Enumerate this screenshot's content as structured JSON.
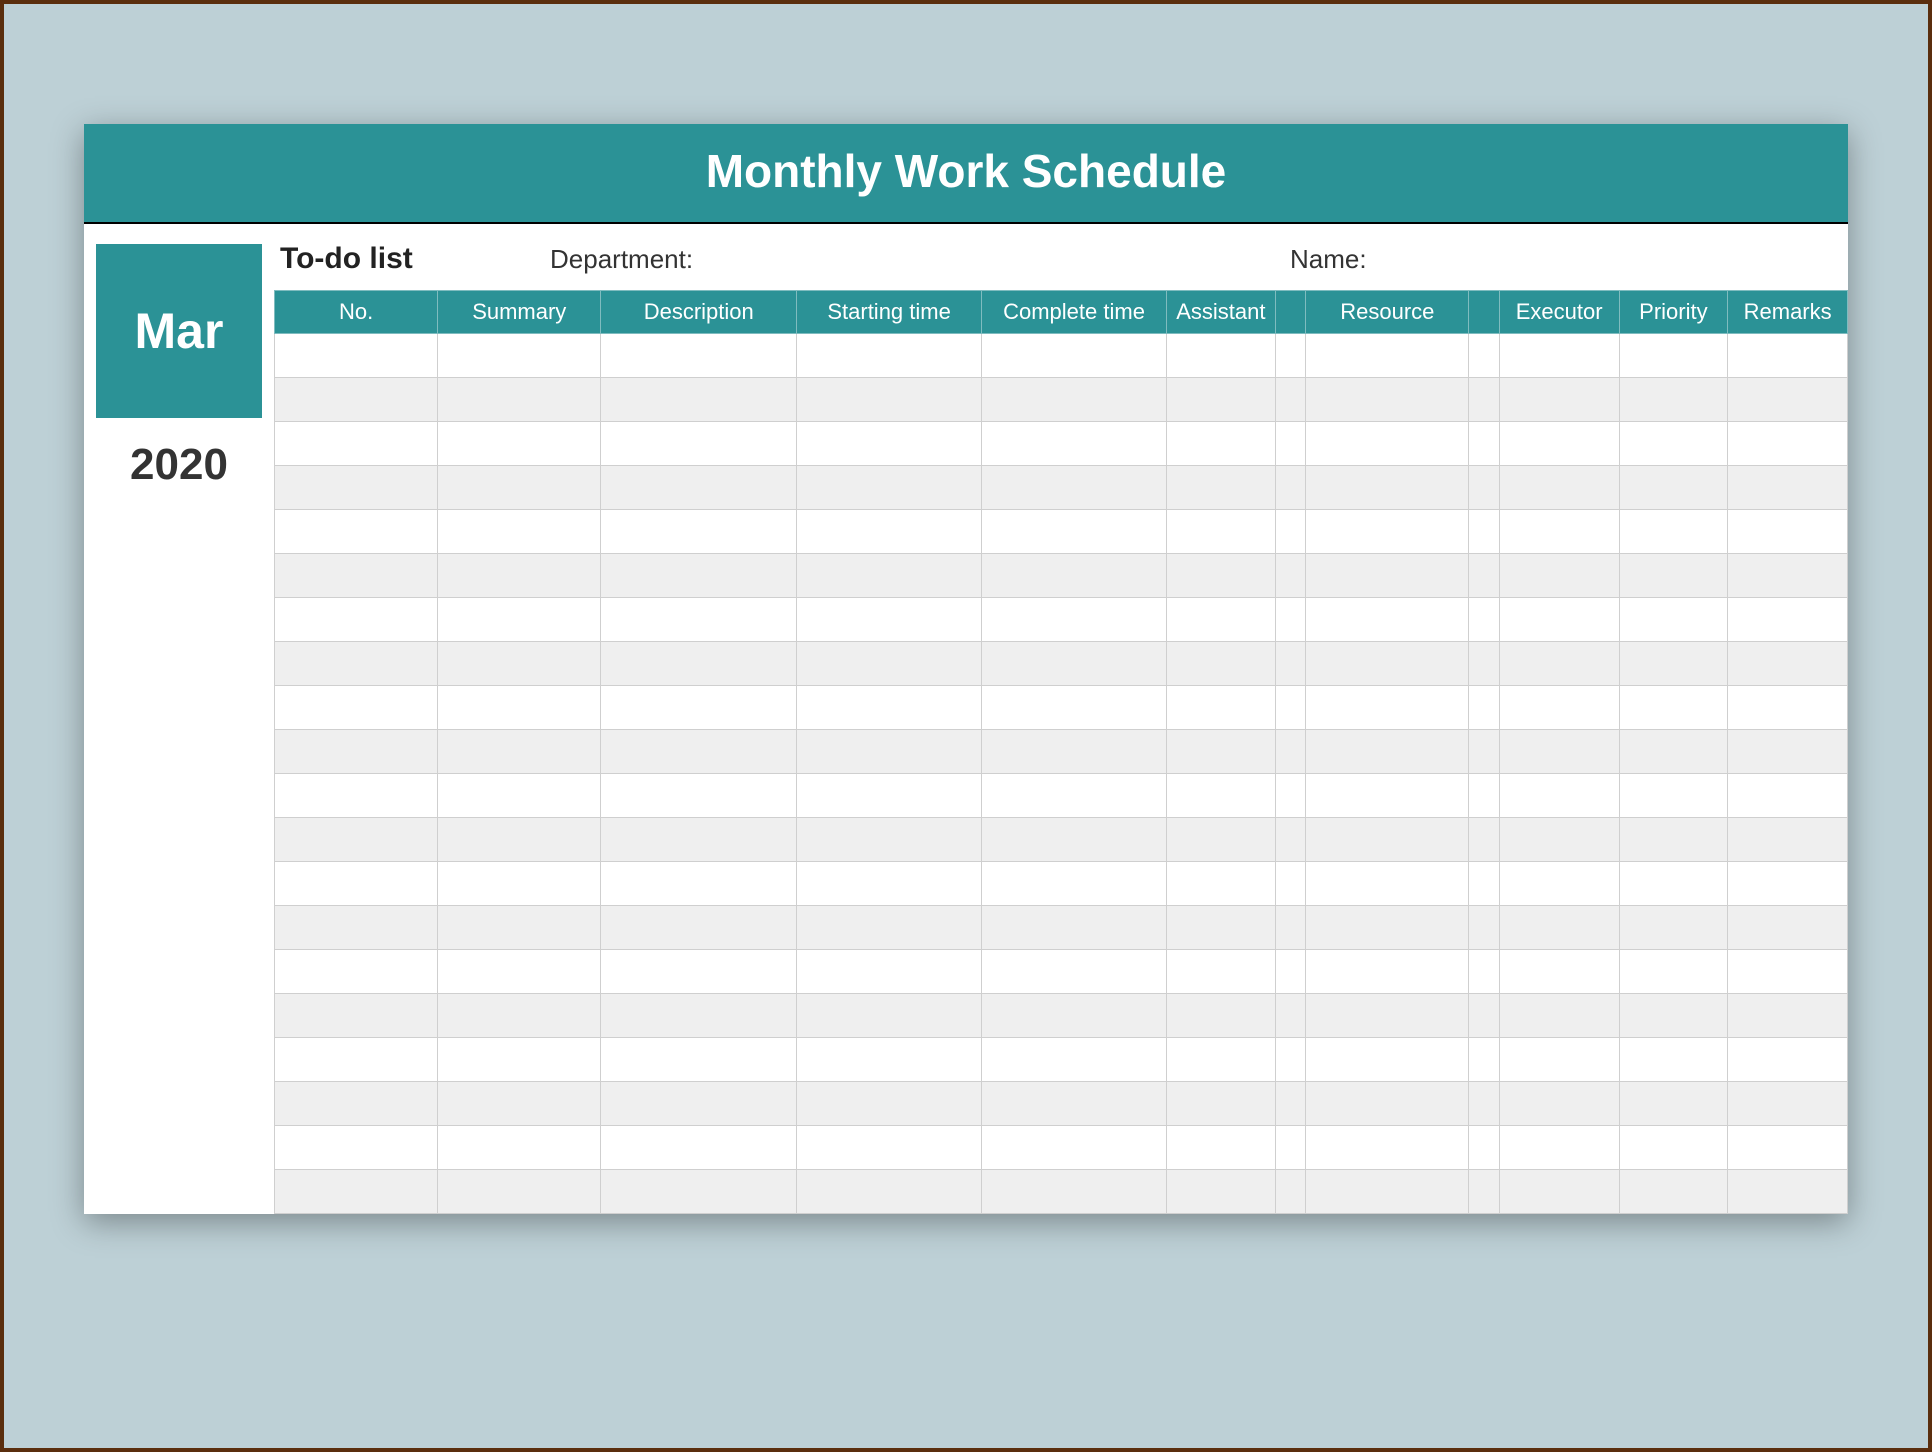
{
  "title": "Monthly Work Schedule",
  "side": {
    "month": "Mar",
    "year": "2020"
  },
  "meta": {
    "todo_label": "To-do list",
    "department_label": "Department:",
    "name_label": "Name:"
  },
  "columns": [
    "No.",
    "Summary",
    "Description",
    "Starting time",
    "Complete time",
    "Assistant",
    "",
    "Resource",
    "",
    "Executor",
    "Priority",
    "Remarks"
  ],
  "row_count": 20,
  "colors": {
    "accent": "#2b9296",
    "page_bg": "#bdd0d6"
  }
}
